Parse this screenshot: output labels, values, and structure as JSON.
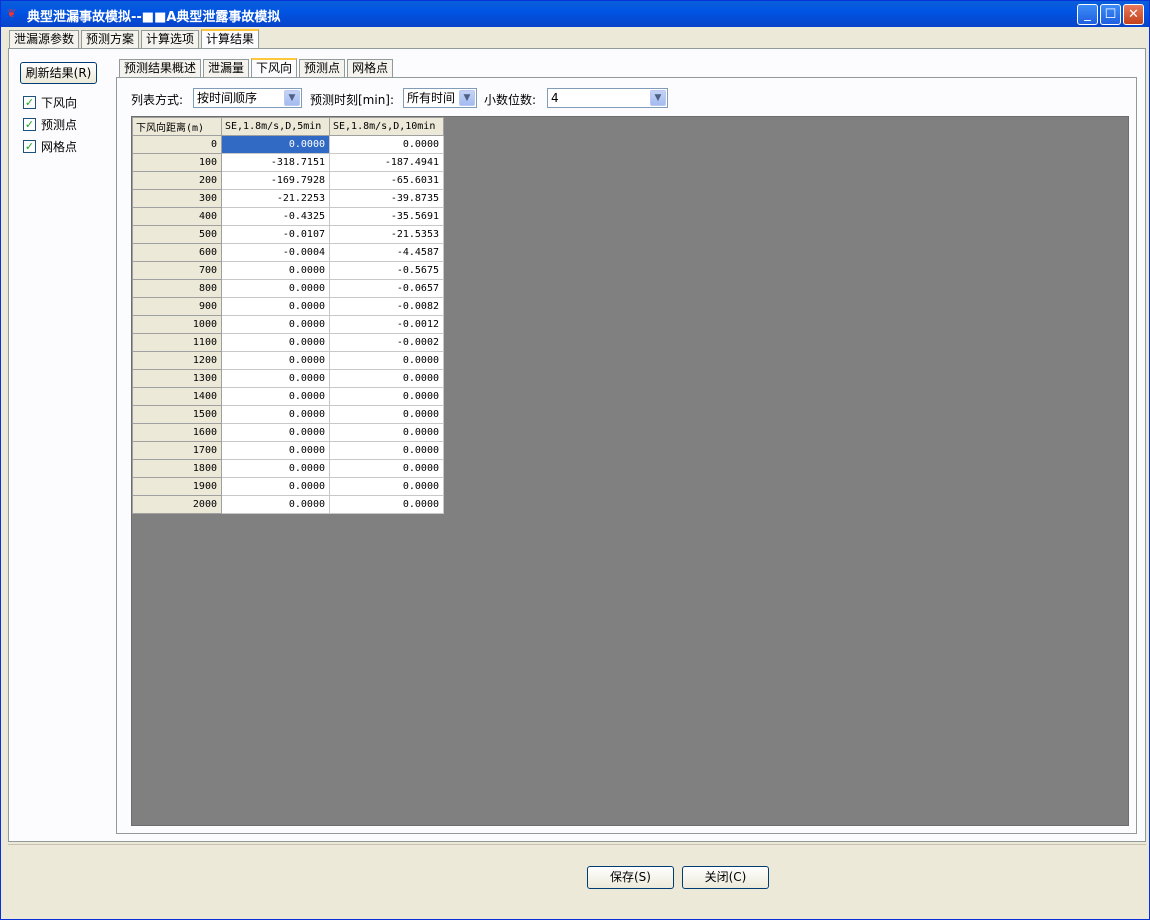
{
  "window": {
    "title": "典型泄漏事故模拟--■■A典型泄露事故模拟"
  },
  "main_tabs": [
    "泄漏源参数",
    "预测方案",
    "计算选项",
    "计算结果"
  ],
  "main_active_tab": 3,
  "left": {
    "refresh_label": "刷新结果(R)",
    "checks": [
      {
        "label": "下风向",
        "checked": true
      },
      {
        "label": "预测点",
        "checked": true
      },
      {
        "label": "网格点",
        "checked": true
      }
    ]
  },
  "inner_tabs": [
    "预测结果概述",
    "泄漏量",
    "下风向",
    "预测点",
    "网格点"
  ],
  "inner_active_tab": 2,
  "controls": {
    "list_label": "列表方式:",
    "list_value": "按时间顺序",
    "time_label": "预测时刻[min]:",
    "time_value": "所有时间",
    "decimal_label": "小数位数:",
    "decimal_value": "4"
  },
  "table": {
    "headers": [
      "下风向距离(m)",
      "SE,1.8m/s,D,5min",
      "SE,1.8m/s,D,10min"
    ],
    "rows": [
      [
        "0",
        "0.0000",
        "0.0000"
      ],
      [
        "100",
        "-318.7151",
        "-187.4941"
      ],
      [
        "200",
        "-169.7928",
        "-65.6031"
      ],
      [
        "300",
        "-21.2253",
        "-39.8735"
      ],
      [
        "400",
        "-0.4325",
        "-35.5691"
      ],
      [
        "500",
        "-0.0107",
        "-21.5353"
      ],
      [
        "600",
        "-0.0004",
        "-4.4587"
      ],
      [
        "700",
        "0.0000",
        "-0.5675"
      ],
      [
        "800",
        "0.0000",
        "-0.0657"
      ],
      [
        "900",
        "0.0000",
        "-0.0082"
      ],
      [
        "1000",
        "0.0000",
        "-0.0012"
      ],
      [
        "1100",
        "0.0000",
        "-0.0002"
      ],
      [
        "1200",
        "0.0000",
        "0.0000"
      ],
      [
        "1300",
        "0.0000",
        "0.0000"
      ],
      [
        "1400",
        "0.0000",
        "0.0000"
      ],
      [
        "1500",
        "0.0000",
        "0.0000"
      ],
      [
        "1600",
        "0.0000",
        "0.0000"
      ],
      [
        "1700",
        "0.0000",
        "0.0000"
      ],
      [
        "1800",
        "0.0000",
        "0.0000"
      ],
      [
        "1900",
        "0.0000",
        "0.0000"
      ],
      [
        "2000",
        "0.0000",
        "0.0000"
      ]
    ]
  },
  "buttons": {
    "save": "保存(S)",
    "close": "关闭(C)"
  },
  "icons": {
    "app": "app-icon",
    "minimize": "minimize-icon",
    "maximize": "maximize-icon",
    "close": "close-icon"
  }
}
